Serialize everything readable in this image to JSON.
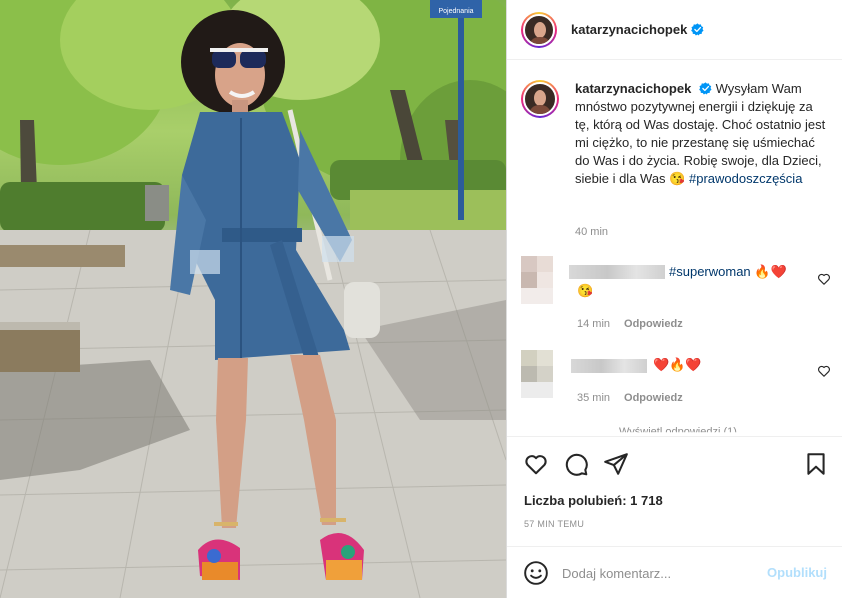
{
  "post": {
    "username": "katarzynacichopek",
    "caption_body": "Wysyłam Wam mnóstwo pozytywnej energii i dziękuję za tę, którą od Was dostaję. Choć ostatnio jest mi ciężko, to nie przestanę się uśmiechać do Was i do życia. Robię swoje, dla Dzieci, siebie i dla Was 😘",
    "hashtag": "#prawodoszczęścia",
    "time": "40 min",
    "likes": "Liczba polubień: 1 718",
    "time_ago": "57 MIN TEMU"
  },
  "comments": [
    {
      "text_hashtag": "#superwoman",
      "emoji": "🔥❤️",
      "emoji2": "😘",
      "time": "14 min",
      "reply": "Odpowiedz"
    },
    {
      "emoji": "❤️🔥❤️",
      "time": "35 min",
      "reply": "Odpowiedz"
    }
  ],
  "view_replies": "Wyświetl odpowiedzi (1)",
  "add_comment": {
    "placeholder": "Dodaj komentarz...",
    "publish": "Opublikuj"
  },
  "street_sign": "Pojednania",
  "colors": {
    "link": "#00376b",
    "publish_disabled": "#b2dffc",
    "meta": "#8e8e8e",
    "verified": "#0095f6"
  },
  "icons": [
    "heart-icon",
    "comment-icon",
    "share-icon",
    "bookmark-icon",
    "emoji-icon",
    "verified-icon"
  ]
}
